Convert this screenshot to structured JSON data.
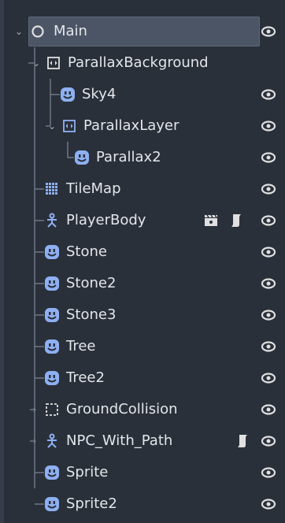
{
  "scene_tree": {
    "nodes": [
      {
        "id": "main",
        "label": "Main",
        "icon": "node-circle-icon",
        "expanded": true,
        "selected": true
      },
      {
        "id": "parallax-background",
        "label": "ParallaxBackground",
        "icon": "parallax-icon",
        "expanded": true
      },
      {
        "id": "sky4",
        "label": "Sky4",
        "icon": "sprite-icon"
      },
      {
        "id": "parallax-layer",
        "label": "ParallaxLayer",
        "icon": "parallax-icon",
        "expanded": true
      },
      {
        "id": "parallax2",
        "label": "Parallax2",
        "icon": "sprite-icon"
      },
      {
        "id": "tilemap",
        "label": "TileMap",
        "icon": "tilemap-icon"
      },
      {
        "id": "playerbody",
        "label": "PlayerBody",
        "icon": "kinematic-body-icon",
        "extras": [
          "instance-icon",
          "script-icon"
        ]
      },
      {
        "id": "stone",
        "label": "Stone",
        "icon": "sprite-icon"
      },
      {
        "id": "stone2",
        "label": "Stone2",
        "icon": "sprite-icon"
      },
      {
        "id": "stone3",
        "label": "Stone3",
        "icon": "sprite-icon"
      },
      {
        "id": "tree",
        "label": "Tree",
        "icon": "sprite-icon"
      },
      {
        "id": "tree2",
        "label": "Tree2",
        "icon": "sprite-icon"
      },
      {
        "id": "groundcollision",
        "label": "GroundCollision",
        "icon": "collision-icon",
        "collapsed": true
      },
      {
        "id": "npc-with-path",
        "label": "NPC_With_Path",
        "icon": "kinematic-body-icon",
        "collapsed": true,
        "extras": [
          "script-icon"
        ]
      },
      {
        "id": "sprite",
        "label": "Sprite",
        "icon": "sprite-icon"
      },
      {
        "id": "sprite2",
        "label": "Sprite2",
        "icon": "sprite-icon"
      }
    ]
  },
  "colors": {
    "background": "#2a303a",
    "selection": "#4c5566",
    "sprite_icon": "#8eb0f2",
    "node_icon": "#e0e0e0",
    "tree_lines": "#6e7684",
    "eye": "#e0e0e0"
  }
}
